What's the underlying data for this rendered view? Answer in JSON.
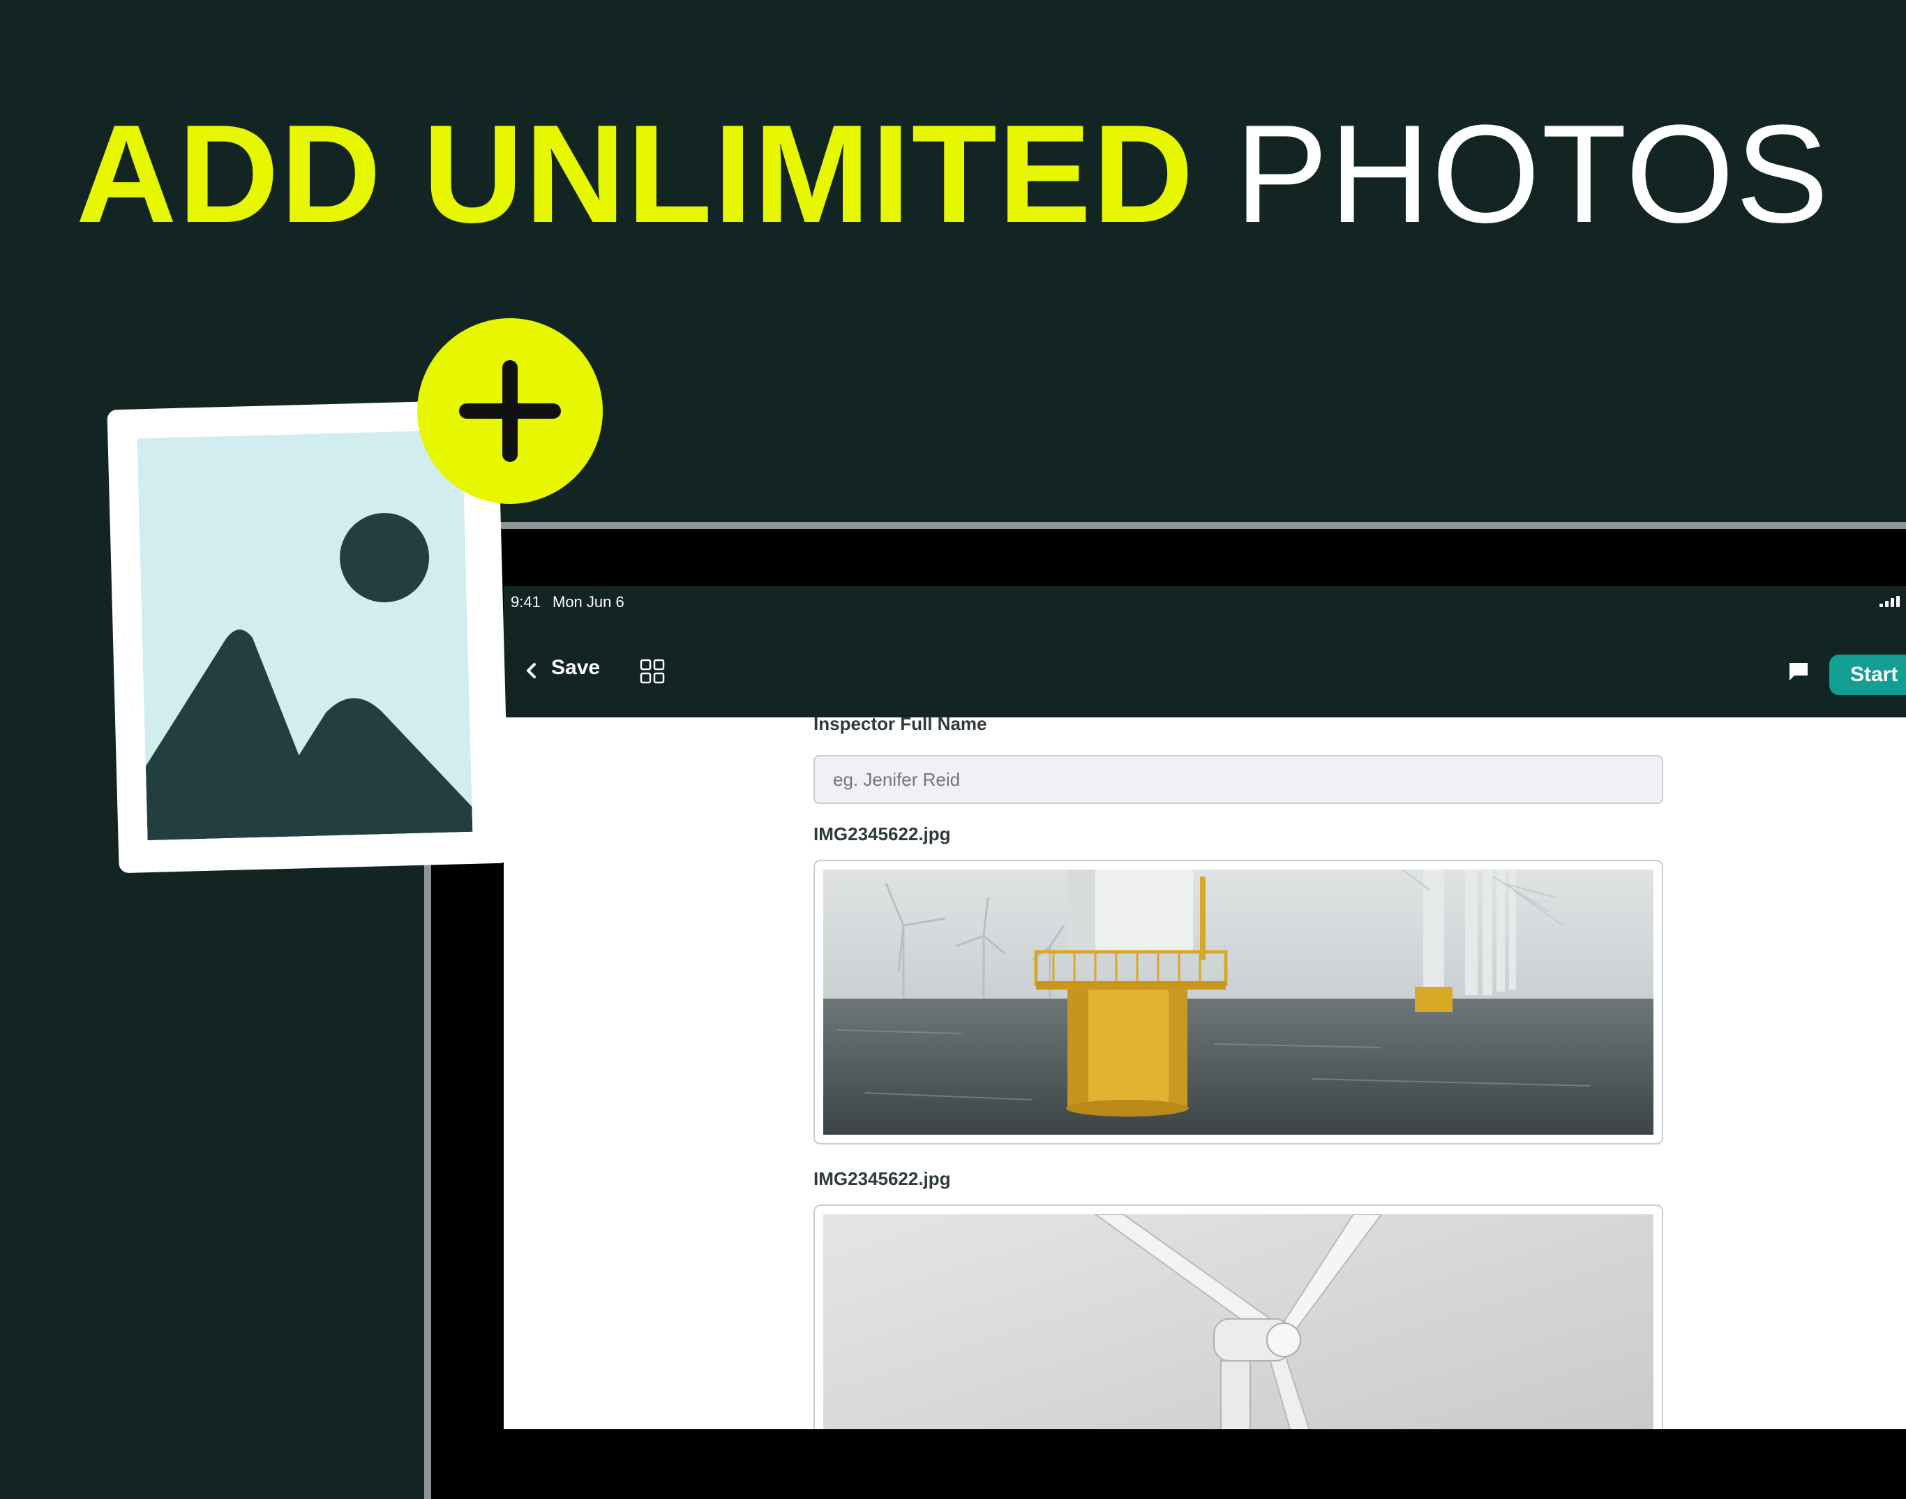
{
  "headline": {
    "accent": "ADD UNLIMITED",
    "plain": "PHOTOS"
  },
  "status_bar": {
    "time": "9:41",
    "date": "Mon Jun 6"
  },
  "nav": {
    "save_label": "Save",
    "start_label": "Start"
  },
  "form": {
    "inspector_label": "Inspector Full Name",
    "inspector_placeholder": "eg. Jenifer Reid",
    "photos": [
      {
        "filename": "IMG2345622.jpg"
      },
      {
        "filename": "IMG2345622.jpg"
      }
    ]
  },
  "colors": {
    "accent": "#E6F700",
    "background": "#132523",
    "button": "#139E93"
  },
  "icons": [
    "plus-icon",
    "image-placeholder-icon",
    "back-chevron-icon",
    "grid-icon",
    "comment-icon",
    "signal-icon"
  ]
}
